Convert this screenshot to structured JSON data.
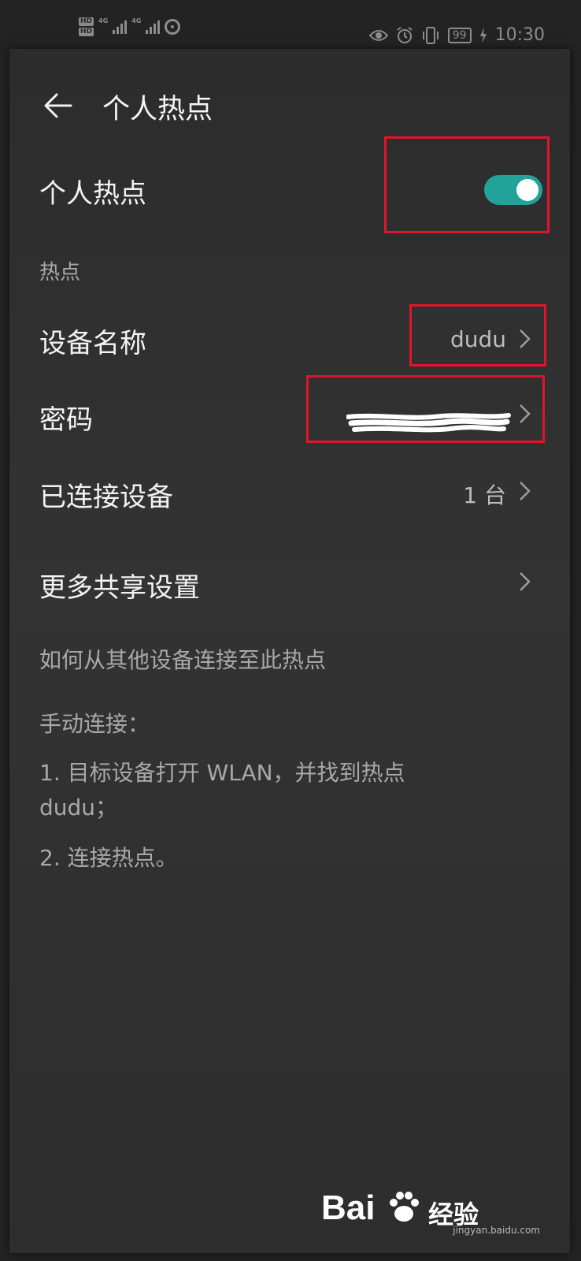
{
  "status_bar": {
    "network_1": "4G",
    "network_2": "4G",
    "battery": "99",
    "time": "10:30"
  },
  "header": {
    "title": "个人热点"
  },
  "hotspot_toggle": {
    "label": "个人热点",
    "enabled": true,
    "accent_color": "#22a39a"
  },
  "section_title": "热点",
  "rows": {
    "device_name": {
      "label": "设备名称",
      "value": "dudu"
    },
    "password": {
      "label": "密码",
      "value": ""
    },
    "connected_devices": {
      "label": "已连接设备",
      "value": "1 台"
    },
    "more_sharing": {
      "label": "更多共享设置"
    }
  },
  "help": {
    "heading": "如何从其他设备连接至此热点",
    "manual": "手动连接：",
    "step1_line1": "1. 目标设备打开 WLAN，并找到热点",
    "step1_line2": "dudu；",
    "step2": "2. 连接热点。"
  },
  "watermark": {
    "brand_left": "Bai",
    "brand_right": "经验",
    "url": "jingyan.baidu.com"
  },
  "icons": [
    "hd-icon",
    "signal-icon",
    "hotspot-icon",
    "eye-icon",
    "alarm-icon",
    "vibrate-icon",
    "charging-icon",
    "back-arrow-icon",
    "chevron-right-icon",
    "paw-icon"
  ]
}
